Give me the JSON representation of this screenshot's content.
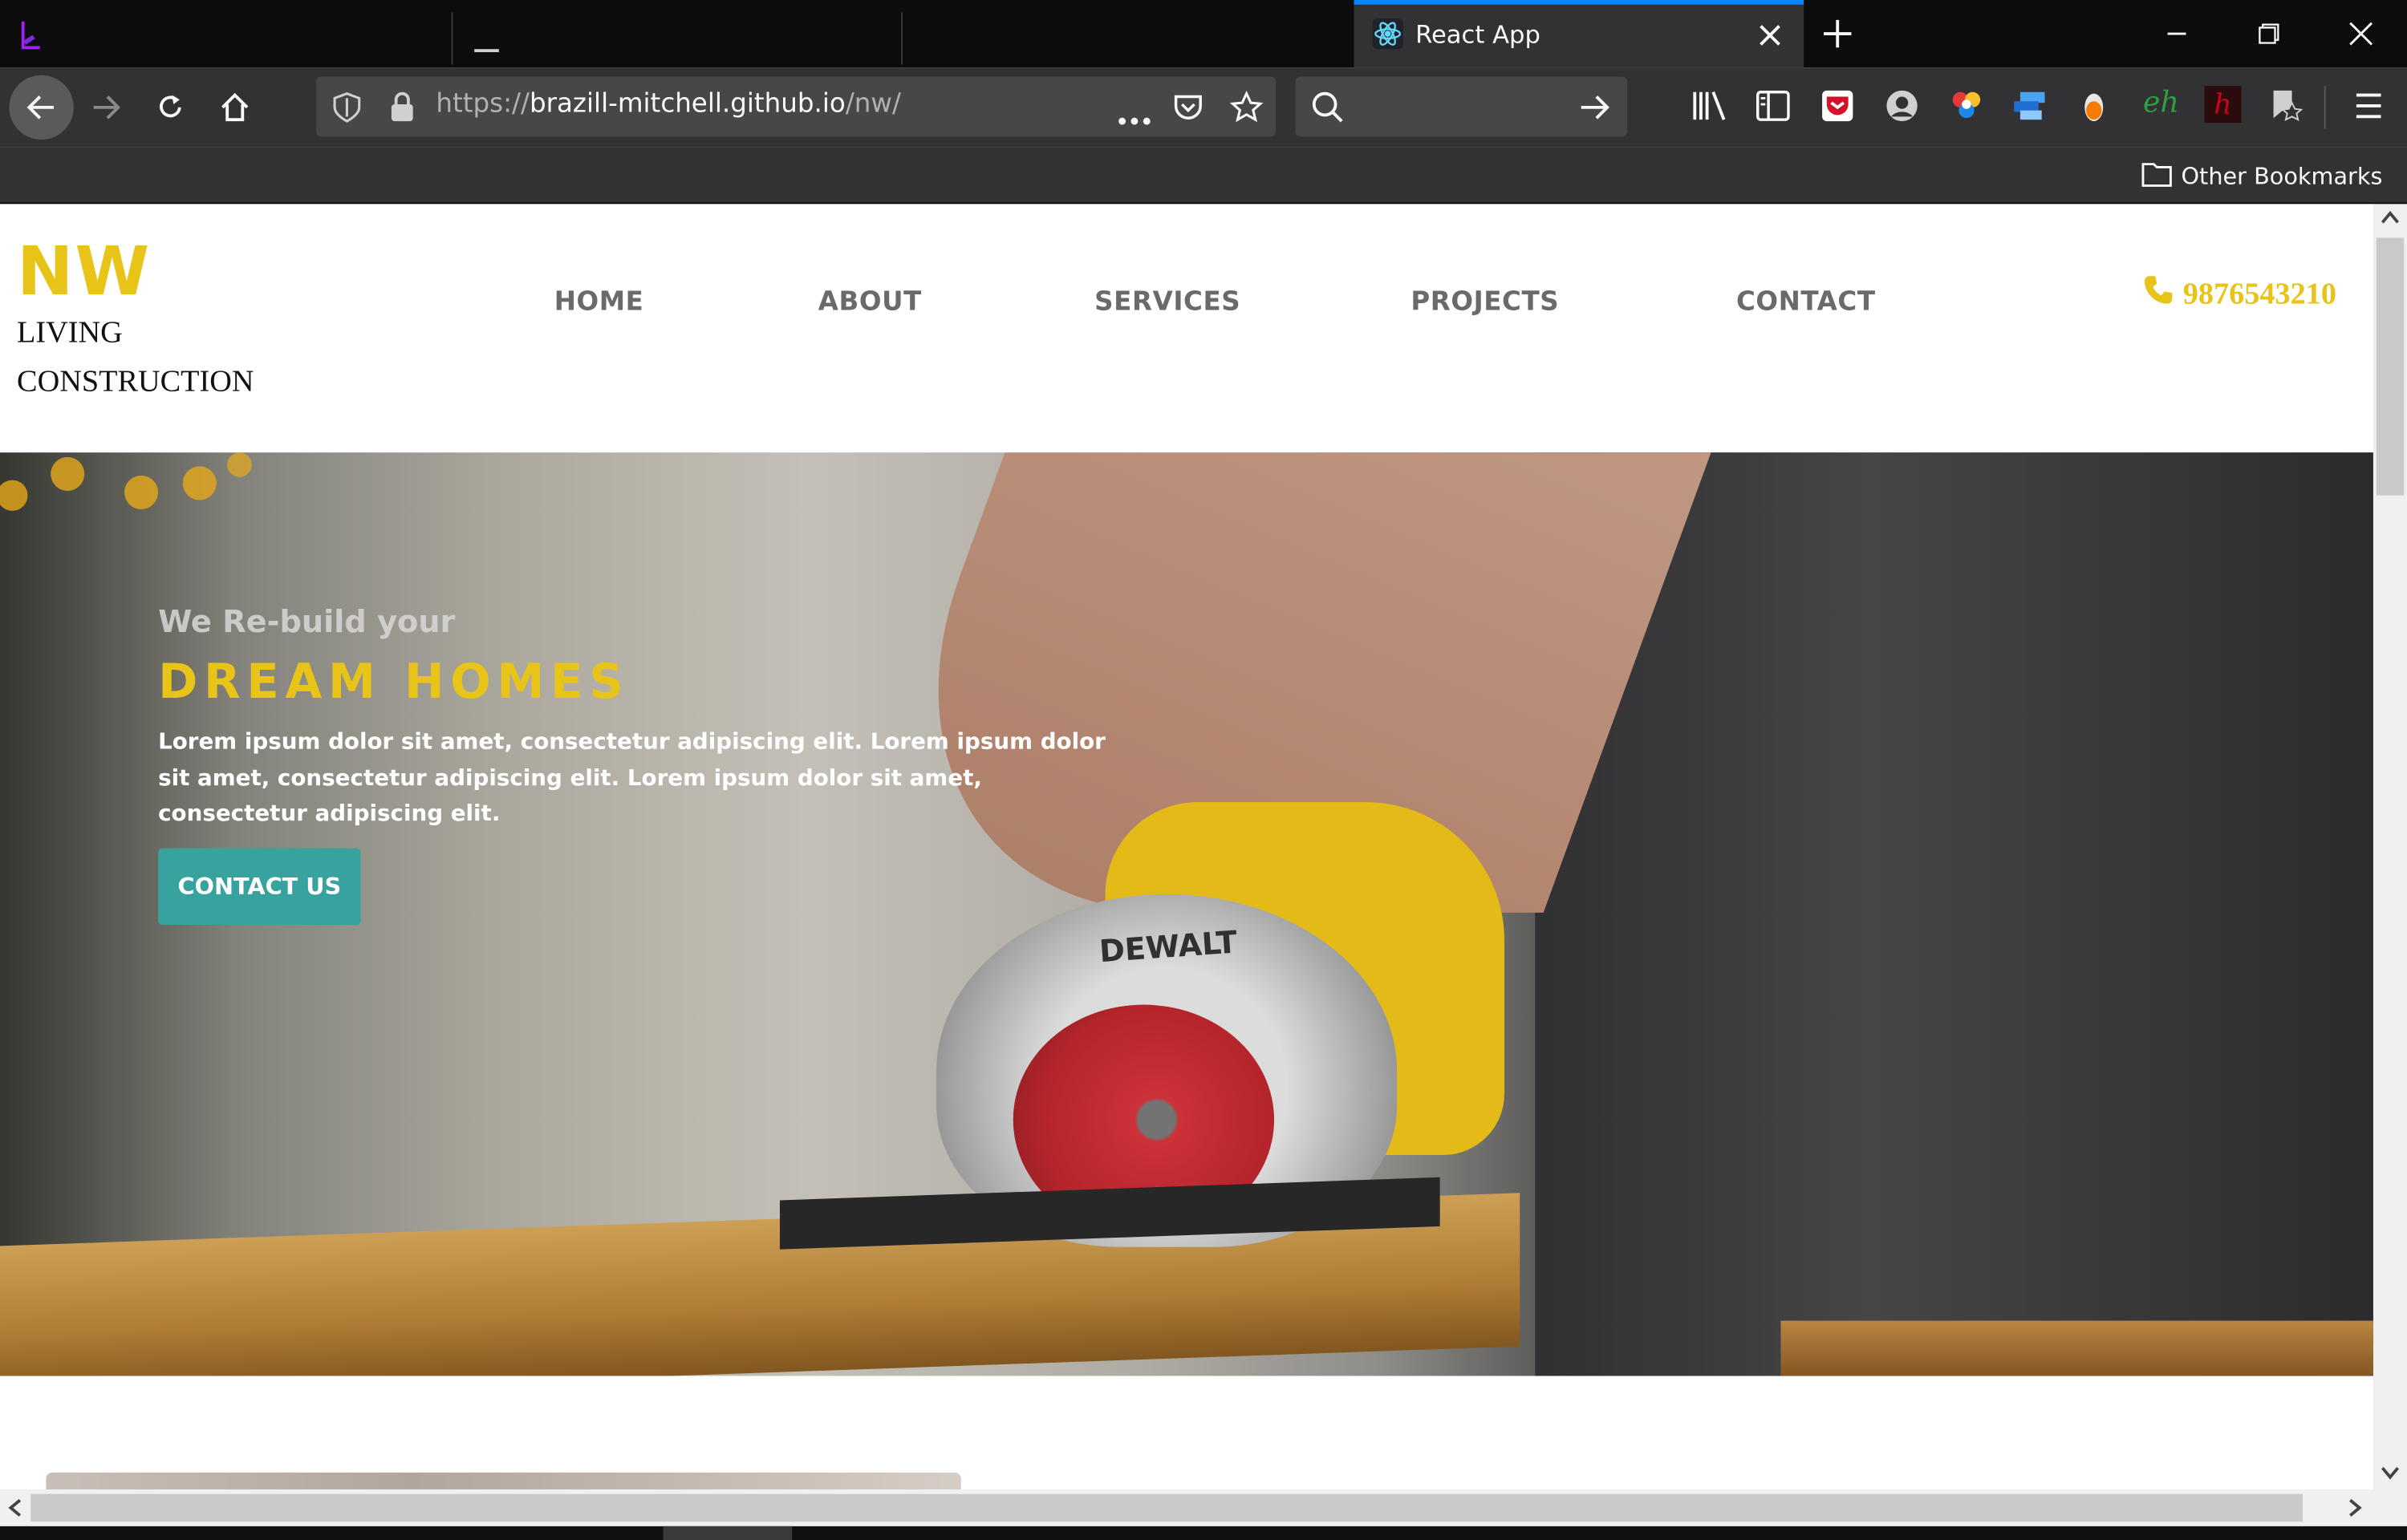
{
  "browser": {
    "tabs": [
      {
        "title": "",
        "icon": "app-logo-icon"
      },
      {
        "title": "",
        "icon": "minimized-icon"
      },
      {
        "title": "",
        "icon": ""
      },
      {
        "title": "React App",
        "icon": "react-icon",
        "active": true
      }
    ],
    "new_tab_icon": "plus-icon",
    "window_controls": [
      "minimize-icon",
      "restore-icon",
      "close-icon"
    ],
    "url": {
      "prefix": "https://",
      "host": "brazill-mitchell.github.io",
      "path": "/nw/"
    },
    "search_placeholder": "",
    "bookmarks": {
      "other_label": "Other Bookmarks"
    },
    "toolbar_icons": [
      "library-icon",
      "sidebar-icon",
      "pocket-icon",
      "account-icon",
      "colors-icon",
      "extension-icon",
      "orange-dot-icon",
      "eh-icon",
      "hypothesis-icon",
      "bookmark-star-icon",
      "menu-icon"
    ],
    "toolbar_text": {
      "eh": "eh",
      "h": "h"
    }
  },
  "site": {
    "logo": {
      "main": "NW",
      "line1": "LIVING",
      "line2": "CONSTRUCTION"
    },
    "nav": [
      "HOME",
      "ABOUT",
      "SERVICES",
      "PROJECTS",
      "CONTACT"
    ],
    "phone": "9876543210",
    "hero": {
      "kicker": "We Re-build your",
      "headline": "DREAM HOMES",
      "body": "Lorem ipsum dolor sit amet, consectetur adipiscing elit. Lorem ipsum dolor sit amet, consectetur adipiscing elit. Lorem ipsum dolor sit amet, consectetur adipiscing elit.",
      "button": "CONTACT US",
      "image_brand": "DEWALT"
    }
  },
  "colors": {
    "accent": "#e8c419",
    "button": "#38a39e",
    "nav_text": "#6a6a6a",
    "chrome": "#323234",
    "tab_active_line": "#0a84ff"
  }
}
